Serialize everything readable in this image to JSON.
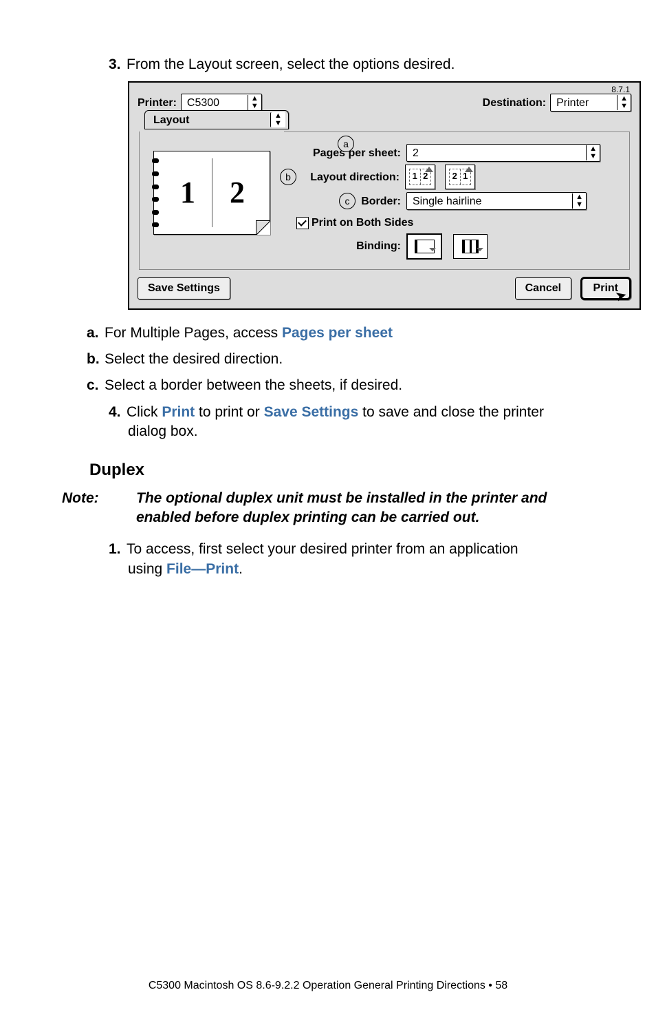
{
  "step3": {
    "num": "3.",
    "text": "From the Layout screen, select the options desired."
  },
  "dialog": {
    "version": "8.7.1",
    "printerLabel": "Printer:",
    "printerValue": "C5300",
    "destinationLabel": "Destination:",
    "destinationValue": "Printer",
    "tab": "Layout",
    "markers": {
      "a": "a",
      "b": "b",
      "c": "c"
    },
    "preview": {
      "one": "1",
      "two": "2"
    },
    "ppsLabel": "Pages per sheet:",
    "ppsValue": "2",
    "ldLabel": "Layout direction:",
    "ldOpt1a": "1",
    "ldOpt1b": "2",
    "ldOpt2a": "2",
    "ldOpt2b": "1",
    "borderLabel": "Border:",
    "borderValue": "Single hairline",
    "pobs": "Print on Both Sides",
    "bindingLabel": "Binding:",
    "saveSettings": "Save Settings",
    "cancel": "Cancel",
    "print": "Print"
  },
  "substeps": {
    "a": {
      "l": "a.",
      "pre": "For Multiple Pages, access ",
      "accent": "Pages per sheet"
    },
    "b": {
      "l": "b.",
      "t": "Select the desired direction."
    },
    "c": {
      "l": "c.",
      "t": "Select a border between the sheets, if desired."
    }
  },
  "step4": {
    "num": "4.",
    "p1": "Click ",
    "a1": "Print",
    "p2": " to print or ",
    "a2": "Save Settings",
    "p3": " to save and close the printer",
    "cont": "dialog box."
  },
  "duplexH": "Duplex",
  "note": {
    "label": "Note:",
    "text": "The optional duplex unit must be installed in the printer and enabled before duplex printing can be carried out."
  },
  "dstep1": {
    "num": "1.",
    "p1": "To access, first select your desired printer from an application",
    "cont1": "using ",
    "accent": "File—Print",
    "cont2": "."
  },
  "footer": "C5300 Macintosh OS 8.6-9.2.2 Operation General Printing Directions • 58"
}
